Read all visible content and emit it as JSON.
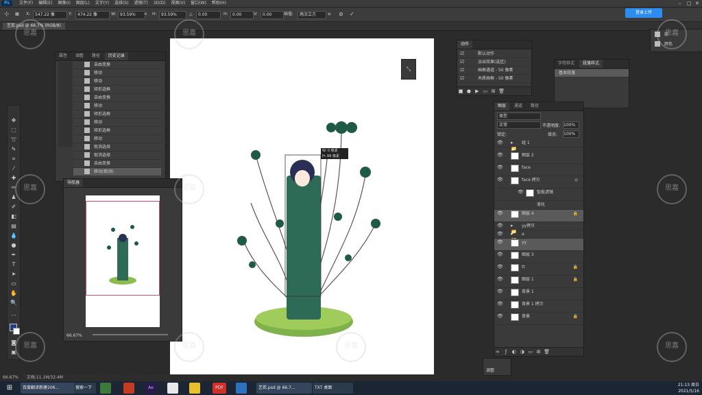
{
  "menubar": {
    "app_logo": "Ps",
    "items": [
      "文件(F)",
      "编辑(E)",
      "图像(I)",
      "图层(L)",
      "文字(Y)",
      "选择(S)",
      "滤镜(T)",
      "3D(D)",
      "视图(V)",
      "窗口(W)",
      "帮助(H)"
    ]
  },
  "options": {
    "x_label": "X:",
    "x_value": "547.22 像",
    "y_label": "Y:",
    "y_value": "474.22 像",
    "w_label": "W:",
    "w_value": "93.59%",
    "h_label": "H:",
    "h_value": "93.59%",
    "angle_label": "△",
    "angle_value": "0.00",
    "hskew_label": "H:",
    "hskew_value": "0.00",
    "vskew_label": "V:",
    "vskew_value": "0.00",
    "interp_label": "插值:",
    "interp_value": "两次立方",
    "login_label": "登录上传"
  },
  "doc_tab": {
    "label": "艺若.psd @ 66.7% (RGB/8)"
  },
  "history_panel": {
    "tabs": [
      "属性",
      "调整",
      "路径",
      "历史记录"
    ],
    "items": [
      "自由变换",
      "移动",
      "移动",
      "矩形选框",
      "自由变换",
      "移动",
      "矩形选框",
      "移动",
      "矩形选框",
      "移动",
      "取消选择",
      "取消选择",
      "自由变换",
      "移动(取消)"
    ]
  },
  "navigator_panel": {
    "title": "导航器",
    "zoom": "66.67%"
  },
  "actions_panel": {
    "title": "动作",
    "items": [
      "默认动作",
      "淡出效果(选区)",
      "画框通道 - 50 像素",
      "木质画框 - 50 像素"
    ]
  },
  "styles_panel": {
    "tabs": [
      "字符样式",
      "段落样式"
    ],
    "item": "基本段落"
  },
  "right_panel": {
    "items": [
      "库",
      "颜色"
    ]
  },
  "layers_panel": {
    "tabs": [
      "图层",
      "通道",
      "路径"
    ],
    "search_placeholder": "类型",
    "blend_mode": "正常",
    "opacity_label": "不透明度:",
    "opacity_value": "100%",
    "fill_label": "填充:",
    "fill_value": "100%",
    "lock_label": "锁定:",
    "layers": [
      {
        "name": "组 1",
        "folder": true,
        "selected": false
      },
      {
        "name": "图层 2",
        "folder": false,
        "selected": false
      },
      {
        "name": "face",
        "folder": false,
        "selected": false
      },
      {
        "name": "face 拷贝",
        "folder": false,
        "selected": false
      },
      {
        "name": "智能滤镜",
        "folder": false,
        "selected": false
      },
      {
        "name": "液化",
        "folder": false,
        "selected": false
      },
      {
        "name": "图层 4",
        "folder": false,
        "selected": true
      },
      {
        "name": "yy拷贝",
        "folder": true,
        "selected": false
      },
      {
        "name": "a",
        "folder": true,
        "selected": false
      },
      {
        "name": "yy",
        "folder": false,
        "selected": true
      },
      {
        "name": "图层 3",
        "folder": false,
        "selected": false
      },
      {
        "name": "tt",
        "folder": false,
        "selected": false
      },
      {
        "name": "图层 1",
        "folder": false,
        "selected": false
      },
      {
        "name": "背景 1",
        "folder": false,
        "selected": false
      },
      {
        "name": "背景 1 拷贝",
        "folder": false,
        "selected": false
      },
      {
        "name": "背景",
        "folder": false,
        "selected": false
      }
    ]
  },
  "adjust_panel": {
    "label": "调整"
  },
  "canvas_overlay": {
    "line1": "W: 0 像素",
    "line2": "H: 88 像素"
  },
  "status": {
    "zoom": "66.67%",
    "doc": "文档:11.1M/32.4M"
  },
  "watermark": "思嘉",
  "taskbar": {
    "items": [
      "百度翻译新建206...",
      "搜索一下",
      "",
      "",
      "Ae",
      "",
      "",
      "PDF",
      "",
      "",
      "艺若.psd @ 66.7...",
      "TXT 桌面"
    ],
    "time": "21:13 周日",
    "date": "2021/5/16"
  }
}
